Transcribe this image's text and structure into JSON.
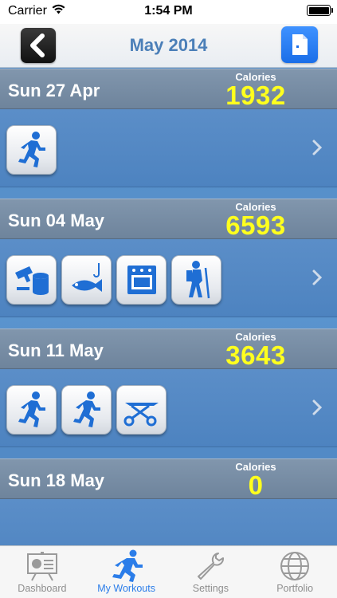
{
  "status_bar": {
    "carrier": "Carrier",
    "time": "1:54 PM"
  },
  "nav": {
    "title": "May 2014",
    "back_icon": "chevron-left-icon",
    "doc_icon": "document-icon"
  },
  "calories_label": "Calories",
  "days": [
    {
      "date": "Sun 27 Apr",
      "calories": "1932",
      "workouts": [
        "running-icon"
      ]
    },
    {
      "date": "Sun 04 May",
      "calories": "6593",
      "workouts": [
        "painting-icon",
        "fishing-icon",
        "cooking-icon",
        "hiking-icon"
      ]
    },
    {
      "date": "Sun 11 May",
      "calories": "3643",
      "workouts": [
        "running-icon",
        "running-icon",
        "scissors-icon"
      ]
    },
    {
      "date": "Sun 18 May",
      "calories": "0",
      "workouts": []
    }
  ],
  "tabs": [
    {
      "label": "Dashboard",
      "icon": "dashboard-icon",
      "active": false
    },
    {
      "label": "My Workouts",
      "icon": "runner-icon",
      "active": true
    },
    {
      "label": "Settings",
      "icon": "wrench-icon",
      "active": false
    },
    {
      "label": "Portfolio",
      "icon": "globe-icon",
      "active": false
    }
  ],
  "colors": {
    "accent": "#2b7de9",
    "calorie_value": "#ffff1e",
    "title": "#4b7fb8",
    "icon_blue": "#1f6ed4"
  }
}
